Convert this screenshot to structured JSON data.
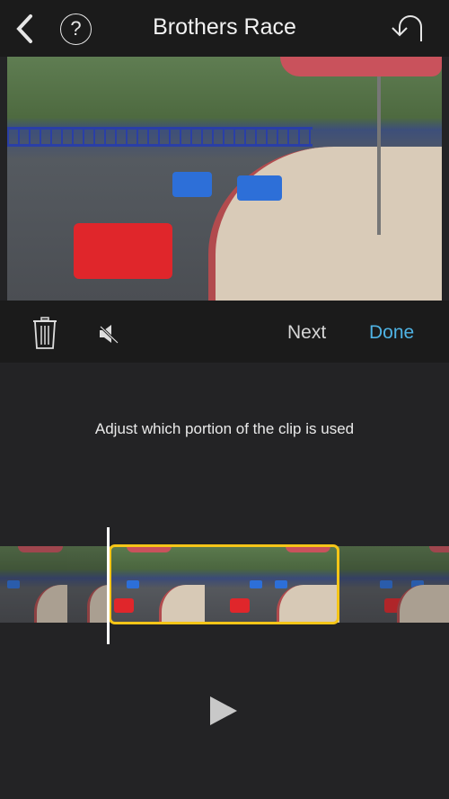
{
  "header": {
    "title": "Brothers Race",
    "back_icon": "chevron-left-icon",
    "help_label": "?",
    "undo_icon": "undo-icon"
  },
  "toolbar": {
    "delete_icon": "trash-icon",
    "mute_icon": "speaker-muted-icon",
    "next_label": "Next",
    "done_label": "Done"
  },
  "editor": {
    "hint": "Adjust which portion of the clip is used",
    "play_icon": "play-icon"
  },
  "colors": {
    "accent": "#4fb3e4",
    "selection": "#f5c518",
    "background": "#232325",
    "bar": "#1b1b1b"
  }
}
